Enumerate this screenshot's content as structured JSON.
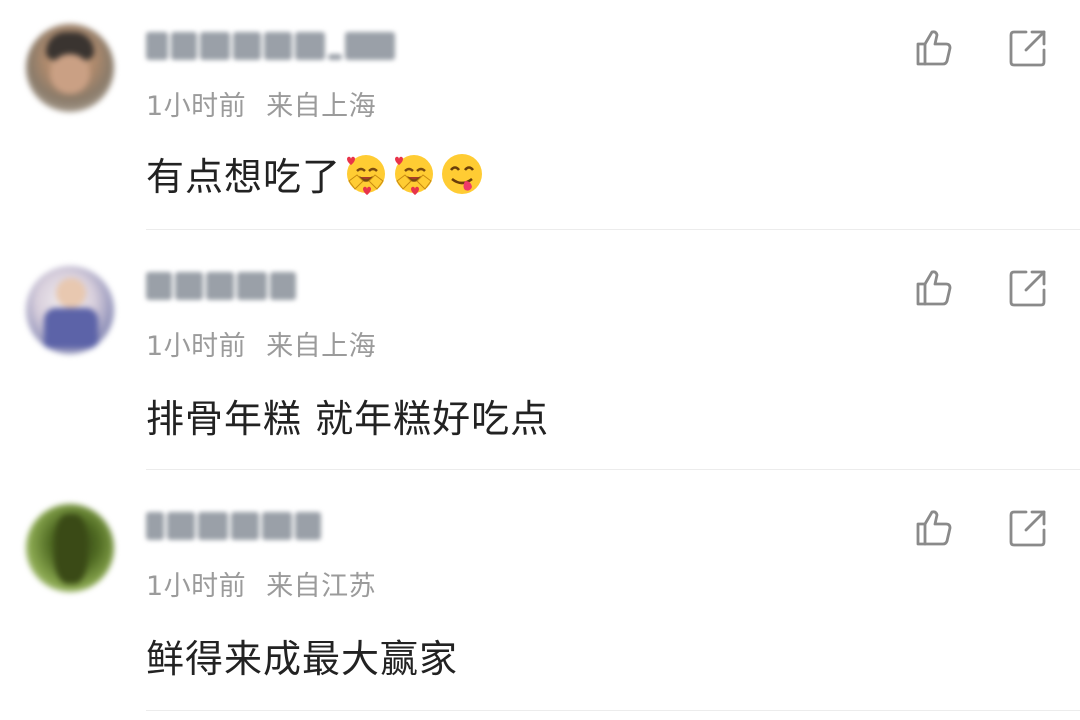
{
  "comments": [
    {
      "username": "",
      "time": "1小时前",
      "location": "来自上海",
      "text": "有点想吃了",
      "emojis": [
        "hugging-face-with-hearts-emoji",
        "hugging-face-with-hearts-emoji",
        "face-savoring-food-emoji"
      ],
      "like_icon": "thumbs-up-icon",
      "share_icon": "share-external-icon"
    },
    {
      "username": "",
      "time": "1小时前",
      "location": "来自上海",
      "text": "排骨年糕 就年糕好吃点",
      "emojis": [],
      "like_icon": "thumbs-up-icon",
      "share_icon": "share-external-icon"
    },
    {
      "username": "",
      "time": "1小时前",
      "location": "来自江苏",
      "text": "鲜得来成最大赢家",
      "emojis": [],
      "like_icon": "thumbs-up-icon",
      "share_icon": "share-external-icon"
    }
  ],
  "colors": {
    "text": "#222222",
    "meta": "#9b9b9b",
    "icon": "#8a8a8a",
    "divider": "#ececec",
    "background": "#ffffff"
  }
}
